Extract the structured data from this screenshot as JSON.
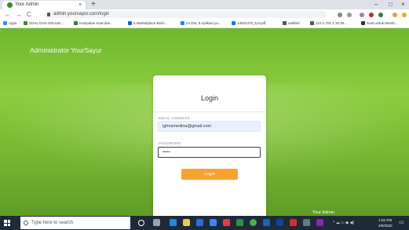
{
  "browser": {
    "tab_title": "Your Admin",
    "url": "admin.yoursayur.com/login",
    "bookmarks": [
      {
        "label": "Apps",
        "color": "#4285f4"
      },
      {
        "label": "SOAL DAN SOLUSI...",
        "color": "#3b8a2a"
      },
      {
        "label": "Kumpulan Soal dan...",
        "color": "#2e7d32"
      },
      {
        "label": "5 Marketplace Berb...",
        "color": "#1565c0"
      },
      {
        "label": "mi Ota, 5 Aplikasi ya...",
        "color": "#1e88e5"
      },
      {
        "label": "14531470_5,8.pdf",
        "color": "#1976d2"
      },
      {
        "label": "untitled",
        "color": "#555555"
      },
      {
        "label": "210.1.701.1.10.30...",
        "color": "#555555"
      },
      {
        "label": "Soal Untuk Memb...",
        "color": "#333333"
      }
    ]
  },
  "page": {
    "brand": "Administrator YourSayur",
    "login_title": "Login",
    "email_label": "EMAIL ADDRESS",
    "email_value": "ighnamedina@gmail.com",
    "password_label": "PASSWORD",
    "password_value": "•••••",
    "login_button": "Login",
    "footer": "Your Admin"
  },
  "taskbar": {
    "search_placeholder": "Type here to search",
    "time": "1:51 PM",
    "date": "4/5/2020"
  }
}
